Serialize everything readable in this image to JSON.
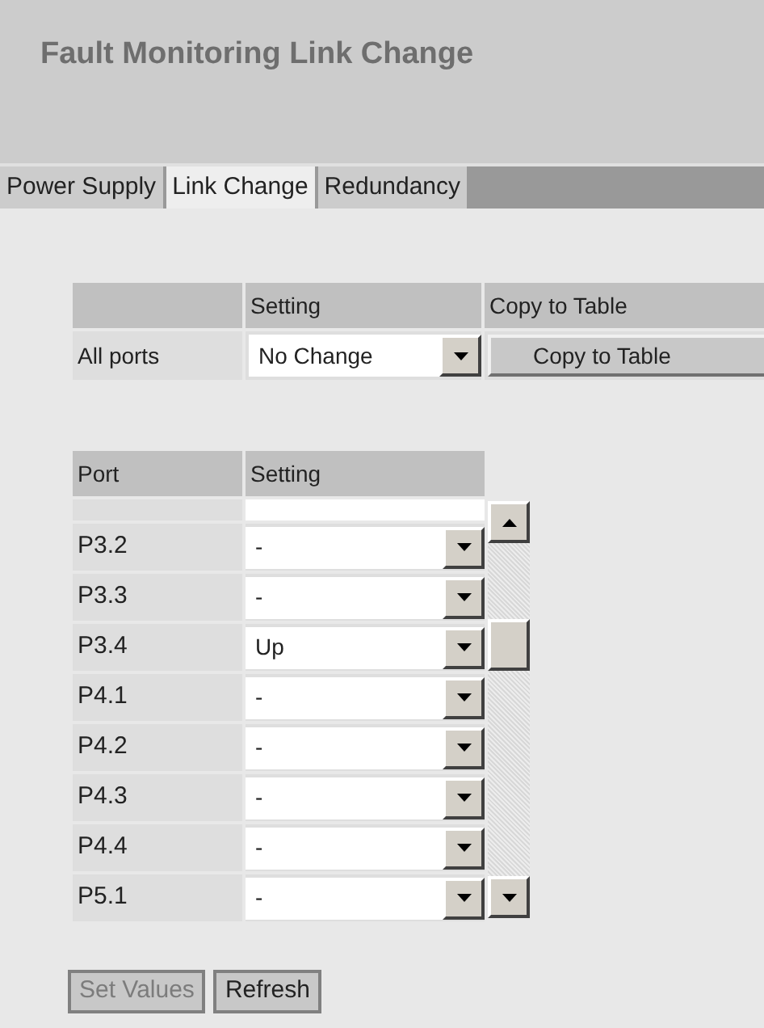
{
  "title": "Fault Monitoring Link Change",
  "tabs": [
    {
      "label": "Power Supply",
      "selected": false
    },
    {
      "label": "Link Change",
      "selected": true
    },
    {
      "label": "Redundancy",
      "selected": false
    }
  ],
  "all_ports_table": {
    "columns": [
      "Setting",
      "Copy to Table"
    ],
    "row_label": "All ports",
    "setting": "No Change",
    "button": "Copy to Table"
  },
  "port_table": {
    "columns": [
      "Port",
      "Setting"
    ],
    "rows": [
      {
        "port": "P3.2",
        "setting": "-"
      },
      {
        "port": "P3.3",
        "setting": "-"
      },
      {
        "port": "P3.4",
        "setting": "Up"
      },
      {
        "port": "P4.1",
        "setting": "-"
      },
      {
        "port": "P4.2",
        "setting": "-"
      },
      {
        "port": "P4.3",
        "setting": "-"
      },
      {
        "port": "P4.4",
        "setting": "-"
      },
      {
        "port": "P5.1",
        "setting": "-"
      }
    ]
  },
  "buttons": [
    {
      "label": "Set Values",
      "disabled": true
    },
    {
      "label": "Refresh",
      "disabled": false
    }
  ]
}
